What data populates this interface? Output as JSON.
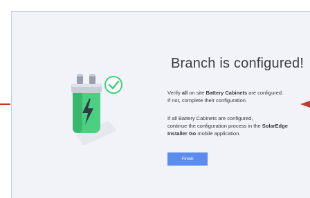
{
  "dialog": {
    "title": "Branch is configured!",
    "paragraph1": {
      "part1": "Verify ",
      "bold1": "all",
      "part2": " on site ",
      "bold2": "Battery Cabinets",
      "part3": " are configured.",
      "line2": "If not, complete their configuration."
    },
    "paragraph2": {
      "line1": "If all Battery Cabinets are configured,",
      "part1": "continue the configuration process in the ",
      "bold1": "SolarEdge",
      "bold2": "Installer Go",
      "part2": " mobile application."
    },
    "finish_label": "Finish"
  },
  "colors": {
    "accent": "#5b8cf0",
    "check": "#3fcf7a",
    "battery_green": "#46d07f",
    "marker": "#c0392b"
  },
  "icons": {
    "battery": "battery-icon",
    "check": "check-circle-icon"
  }
}
